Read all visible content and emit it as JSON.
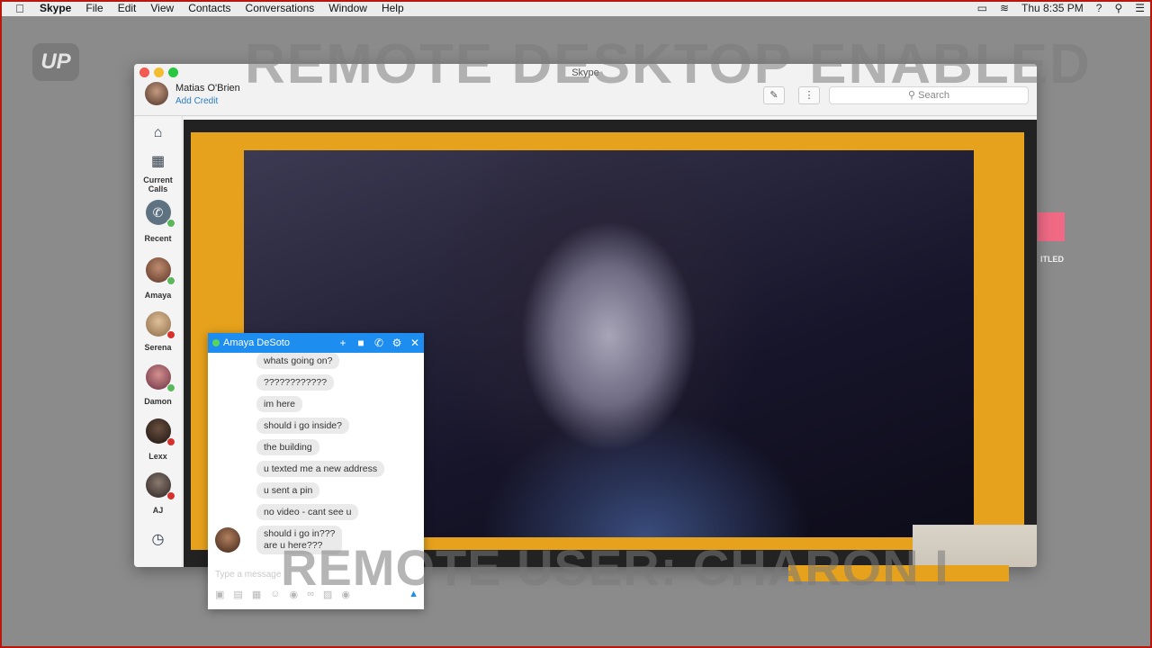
{
  "menubar": {
    "app": "Skype",
    "items": [
      "File",
      "Edit",
      "View",
      "Contacts",
      "Conversations",
      "Window",
      "Help"
    ],
    "clock": "Thu 8:35 PM",
    "help_glyph": "?"
  },
  "desktop": {
    "logo": "UP",
    "side_label": "TITLED",
    "side_label_bind": "ITLED"
  },
  "overlays": {
    "top": "REMOTE DESKTOP ENABLED",
    "bottom": "REMOTE USER: CHARON I"
  },
  "skype": {
    "window_title": "Skype",
    "user_name": "Matias O'Brien",
    "add_credit": "Add Credit",
    "search_placeholder": "Search"
  },
  "sidebar": {
    "current_calls": "Current Calls",
    "recent": "Recent",
    "contacts": [
      {
        "name": "Amaya",
        "status": "online",
        "color": "#8a5a45"
      },
      {
        "name": "Serena",
        "status": "busy",
        "color": "#c9a07a"
      },
      {
        "name": "Damon",
        "status": "online",
        "color": "#b5606a"
      },
      {
        "name": "Lexx",
        "status": "busy",
        "color": "#3a2a22"
      },
      {
        "name": "AJ",
        "status": "busy",
        "color": "#4c4540"
      }
    ]
  },
  "chat": {
    "contact_name": "Amaya DeSoto",
    "messages": [
      "whats going on?",
      "????????????",
      "im here",
      "should i go inside?",
      "the building",
      "u texted me a new address",
      "u sent a pin",
      "no video - cant see u",
      "should i go in???",
      "are u here???"
    ],
    "input_placeholder": "Type a message"
  }
}
